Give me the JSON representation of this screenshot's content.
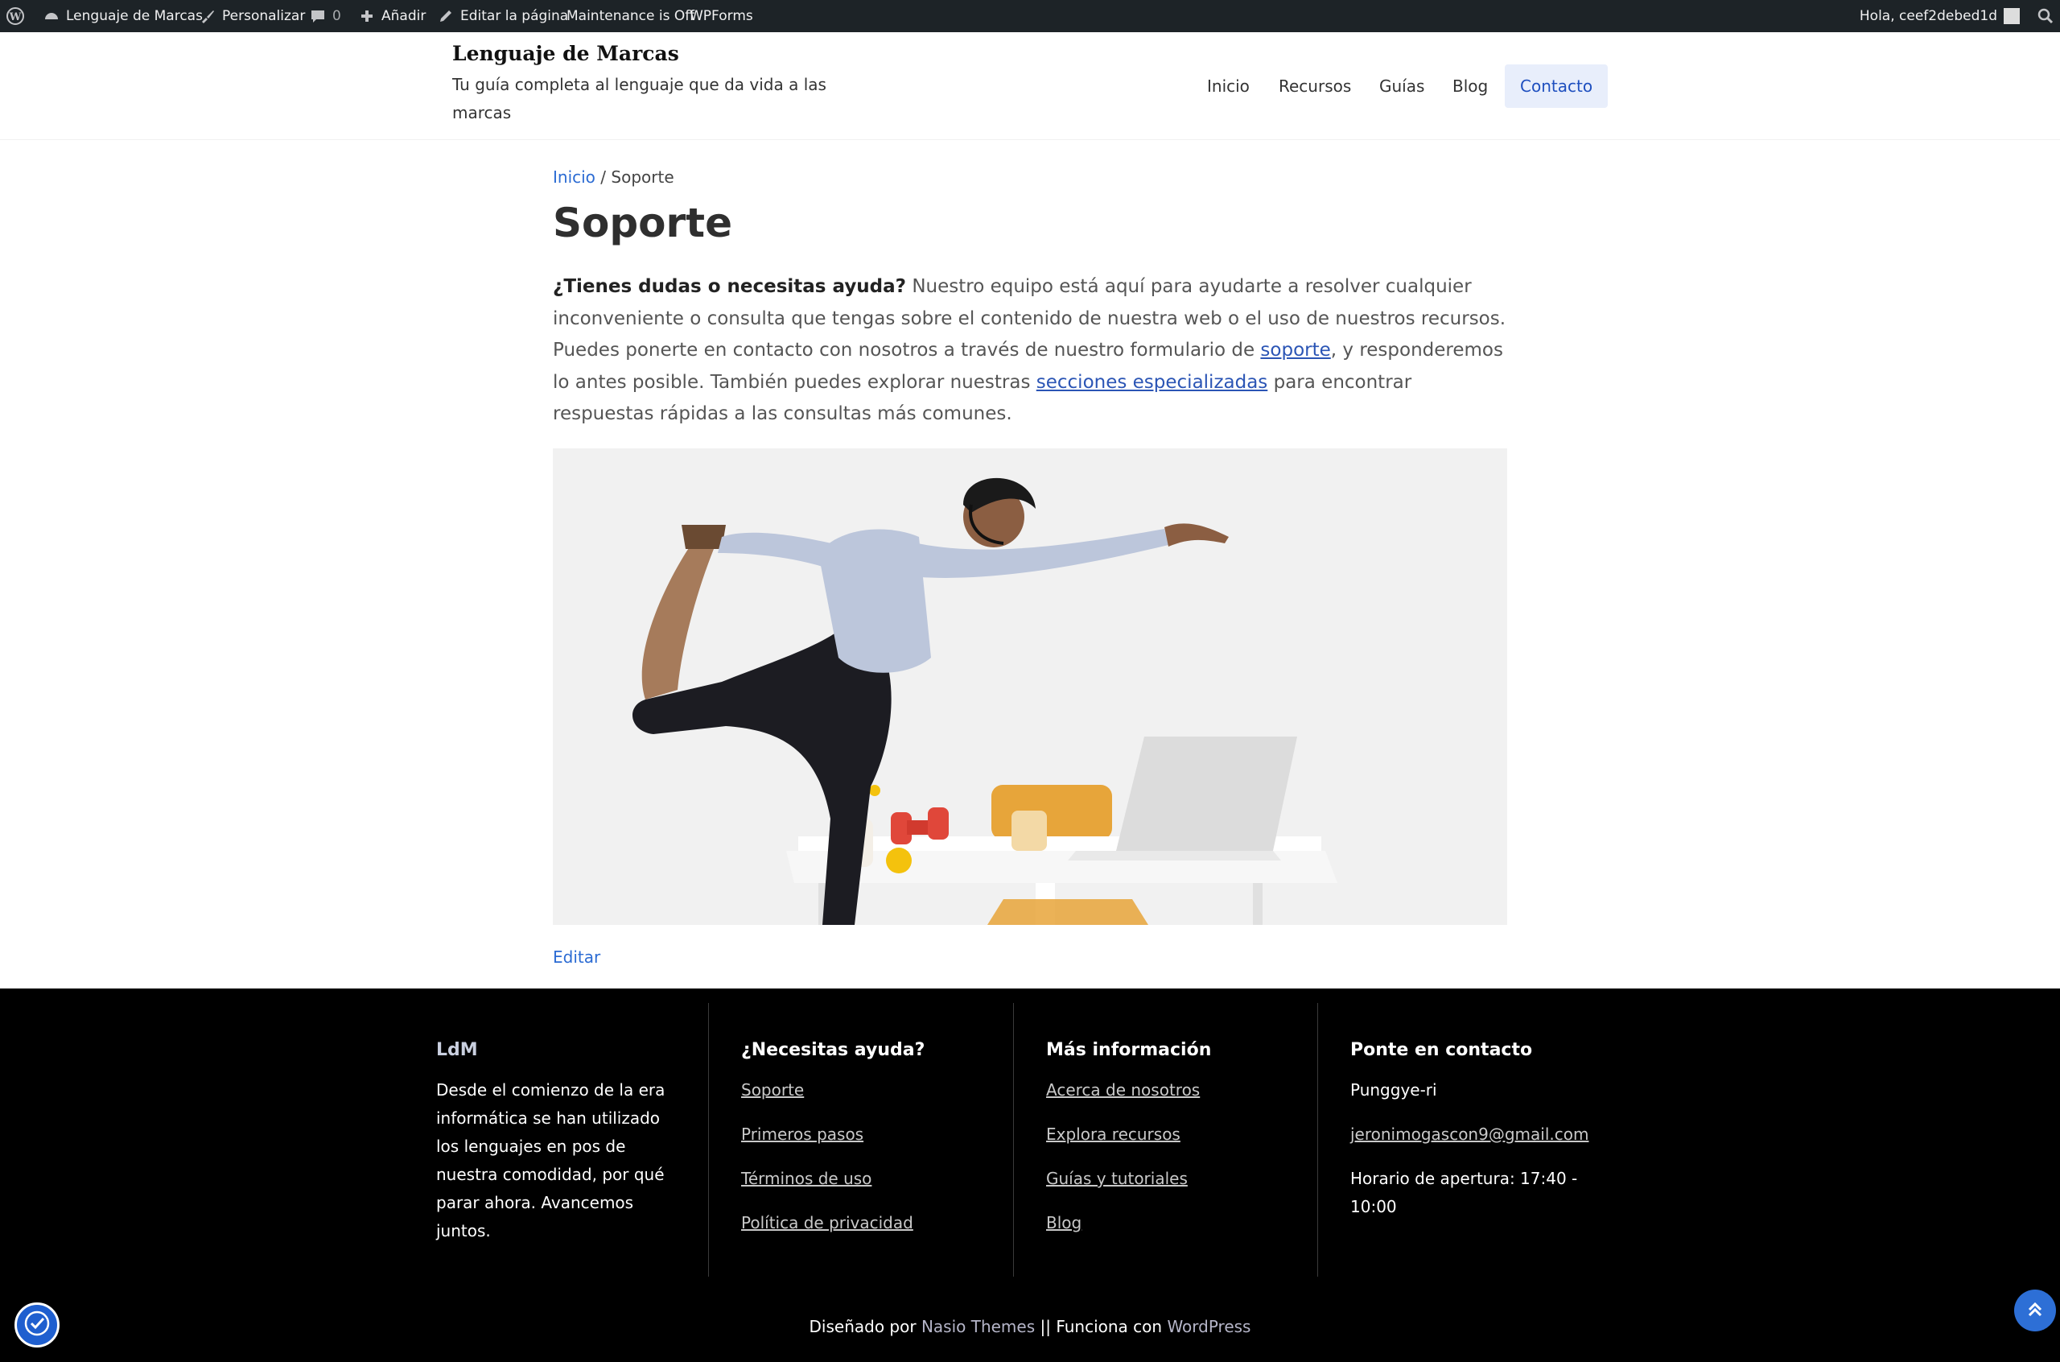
{
  "admin_bar": {
    "site_name": "Lenguaje de Marcas",
    "customize": "Personalizar",
    "comments_count": "0",
    "add_new": "Añadir",
    "edit_page": "Editar la página",
    "maintenance": "Maintenance is Off",
    "wpforms": "WPForms",
    "greeting": "Hola, ceef2debed1d"
  },
  "header": {
    "site_title": "Lenguaje de Marcas",
    "site_description": "Tu guía completa al lenguaje que da vida a las marcas",
    "nav": [
      "Inicio",
      "Recursos",
      "Guías",
      "Blog",
      "Contacto"
    ]
  },
  "breadcrumb": {
    "home": "Inicio",
    "separator": "/",
    "current": "Soporte"
  },
  "page": {
    "title": "Soporte",
    "intro_bold": "¿Tienes dudas o necesitas ayuda?",
    "intro_1": " Nuestro equipo está aquí para ayudarte a resolver cualquier inconveniente o consulta que tengas sobre el contenido de nuestra web o el uso de nuestros recursos. Puedes ponerte en contacto con nosotros a través de nuestro formulario de ",
    "link_soporte": "soporte",
    "intro_2": ", y responderemos lo antes posible. También puedes explorar nuestras ",
    "link_secciones": "secciones especializadas",
    "intro_3": " para encontrar respuestas rápidas a las consultas más comunes.",
    "edit_link": "Editar"
  },
  "footer": {
    "col1": {
      "heading": "LdM",
      "text": "Desde el comienzo de la era informática se han utilizado los lenguajes en pos de nuestra comodidad, por qué parar ahora. Avancemos juntos."
    },
    "col2": {
      "heading": "¿Necesitas ayuda?",
      "links": [
        "Soporte",
        "Primeros pasos",
        "Términos de uso",
        "Política de privacidad"
      ]
    },
    "col3": {
      "heading": "Más información",
      "links": [
        "Acerca de nosotros",
        "Explora recursos",
        "Guías y tutoriales",
        "Blog"
      ]
    },
    "col4": {
      "heading": "Ponte en contacto",
      "location": "Punggye-ri",
      "email": "jeronimogascon9@gmail.com",
      "hours": "Horario de apertura: 17:40 - 10:00"
    },
    "credits": {
      "designed_by": "Diseñado por ",
      "theme": "Nasio Themes",
      "sep": " || Funciona con ",
      "wp": "WordPress"
    }
  },
  "colors": {
    "admin_bar_bg": "#1d2327",
    "accent": "#2b6bd3",
    "footer_bg": "#000000",
    "nav_active_bg": "#e8eefb"
  }
}
